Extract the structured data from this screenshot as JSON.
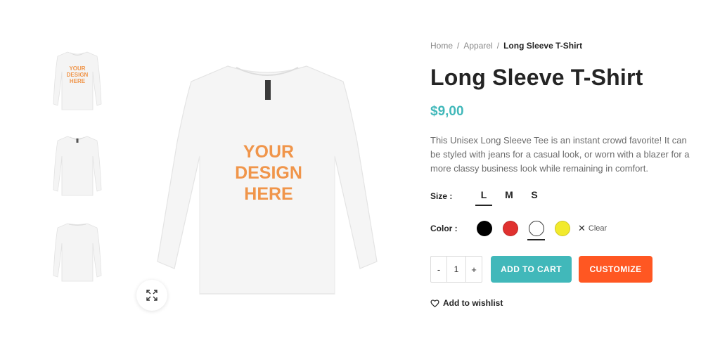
{
  "gallery": {
    "print_lines": [
      "YOUR",
      "DESIGN",
      "HERE"
    ],
    "print_color": "#f0954a",
    "thumbnails": [
      {
        "view": "front-print"
      },
      {
        "view": "front-plain"
      },
      {
        "view": "back-plain"
      }
    ],
    "zoom_icon": "expand-icon"
  },
  "breadcrumb": {
    "items": [
      "Home",
      "Apparel"
    ],
    "current": "Long Sleeve T-Shirt",
    "separator": "/"
  },
  "product": {
    "title": "Long Sleeve T-Shirt",
    "price": "$9,00",
    "price_color": "#41b8ba",
    "description": "This Unisex Long Sleeve Tee is an instant crowd favorite! It can be styled with jeans for a casual look, or worn with a blazer for a more classy business look while remaining in comfort."
  },
  "size": {
    "label": "Size :",
    "options": [
      "L",
      "M",
      "S"
    ],
    "selected": "L"
  },
  "color": {
    "label": "Color :",
    "swatches": [
      "#000000",
      "#e0312f",
      "#ffffff",
      "#f2ea2c"
    ],
    "selected_index": 2,
    "clear_label": "Clear"
  },
  "cart": {
    "minus": "-",
    "quantity": "1",
    "plus": "+",
    "add_to_cart_label": "ADD TO CART",
    "add_to_cart_color": "#41b8ba",
    "customize_label": "CUSTOMIZE",
    "customize_color": "#ff5722"
  },
  "wishlist": {
    "label": "Add to wishlist",
    "icon": "heart-icon"
  }
}
